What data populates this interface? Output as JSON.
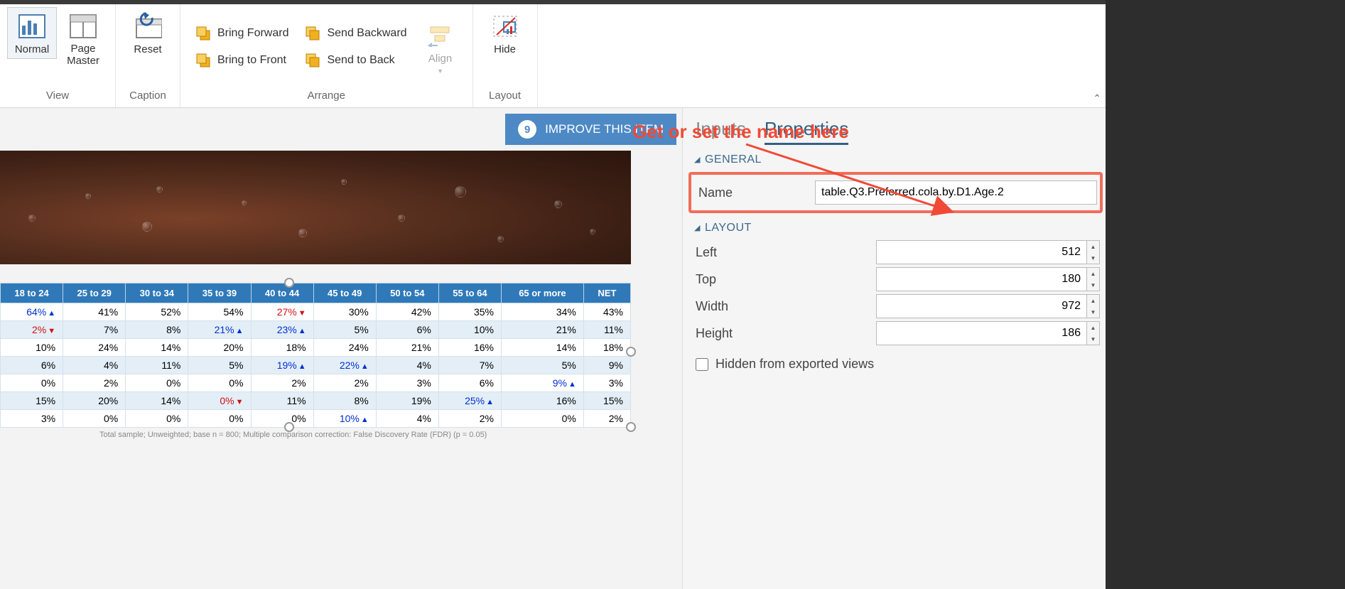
{
  "ribbon": {
    "view": {
      "label": "View",
      "normal": "Normal",
      "pageMaster": "Page\nMaster"
    },
    "caption": {
      "label": "Caption",
      "reset": "Reset"
    },
    "arrange": {
      "label": "Arrange",
      "bringForward": "Bring Forward",
      "sendBackward": "Send Backward",
      "bringToFront": "Bring to Front",
      "sendToBack": "Send to Back",
      "align": "Align"
    },
    "layout": {
      "label": "Layout",
      "hide": "Hide"
    }
  },
  "improve": {
    "count": "9",
    "label": "IMPROVE THIS ITEM"
  },
  "annotation": "Get or set the name here",
  "panel": {
    "tabs": {
      "inputs": "Inputs",
      "properties": "Properties"
    },
    "general": {
      "title": "GENERAL",
      "nameLabel": "Name",
      "nameValue": "table.Q3.Preferred.cola.by.D1.Age.2"
    },
    "layout": {
      "title": "LAYOUT",
      "leftLabel": "Left",
      "leftValue": "512",
      "topLabel": "Top",
      "topValue": "180",
      "widthLabel": "Width",
      "widthValue": "972",
      "heightLabel": "Height",
      "heightValue": "186",
      "hiddenLabel": "Hidden from exported views"
    }
  },
  "table": {
    "headers": [
      "18 to 24",
      "25 to 29",
      "30 to 34",
      "35 to 39",
      "40 to 44",
      "45 to 49",
      "50 to 54",
      "55 to 64",
      "65 or more",
      "NET"
    ],
    "rows": [
      [
        {
          "v": "64%",
          "d": "up"
        },
        {
          "v": "41%"
        },
        {
          "v": "52%"
        },
        {
          "v": "54%"
        },
        {
          "v": "27%",
          "d": "down"
        },
        {
          "v": "30%"
        },
        {
          "v": "42%"
        },
        {
          "v": "35%"
        },
        {
          "v": "34%"
        },
        {
          "v": "43%"
        }
      ],
      [
        {
          "v": "2%",
          "d": "down"
        },
        {
          "v": "7%"
        },
        {
          "v": "8%"
        },
        {
          "v": "21%",
          "d": "up"
        },
        {
          "v": "23%",
          "d": "up"
        },
        {
          "v": "5%"
        },
        {
          "v": "6%"
        },
        {
          "v": "10%"
        },
        {
          "v": "21%"
        },
        {
          "v": "11%"
        }
      ],
      [
        {
          "v": "10%"
        },
        {
          "v": "24%"
        },
        {
          "v": "14%"
        },
        {
          "v": "20%"
        },
        {
          "v": "18%"
        },
        {
          "v": "24%"
        },
        {
          "v": "21%"
        },
        {
          "v": "16%"
        },
        {
          "v": "14%"
        },
        {
          "v": "18%"
        }
      ],
      [
        {
          "v": "6%"
        },
        {
          "v": "4%"
        },
        {
          "v": "11%"
        },
        {
          "v": "5%"
        },
        {
          "v": "19%",
          "d": "up"
        },
        {
          "v": "22%",
          "d": "up"
        },
        {
          "v": "4%"
        },
        {
          "v": "7%"
        },
        {
          "v": "5%"
        },
        {
          "v": "9%"
        }
      ],
      [
        {
          "v": "0%"
        },
        {
          "v": "2%"
        },
        {
          "v": "0%"
        },
        {
          "v": "0%"
        },
        {
          "v": "2%"
        },
        {
          "v": "2%"
        },
        {
          "v": "3%"
        },
        {
          "v": "6%"
        },
        {
          "v": "9%",
          "d": "up"
        },
        {
          "v": "3%"
        }
      ],
      [
        {
          "v": "15%"
        },
        {
          "v": "20%"
        },
        {
          "v": "14%"
        },
        {
          "v": "0%",
          "d": "down"
        },
        {
          "v": "11%"
        },
        {
          "v": "8%"
        },
        {
          "v": "19%"
        },
        {
          "v": "25%",
          "d": "up"
        },
        {
          "v": "16%"
        },
        {
          "v": "15%"
        }
      ],
      [
        {
          "v": "3%"
        },
        {
          "v": "0%"
        },
        {
          "v": "0%"
        },
        {
          "v": "0%"
        },
        {
          "v": "0%"
        },
        {
          "v": "10%",
          "d": "up"
        },
        {
          "v": "4%"
        },
        {
          "v": "2%"
        },
        {
          "v": "0%"
        },
        {
          "v": "2%"
        }
      ]
    ],
    "footnote": "Total sample; Unweighted; base n = 800; Multiple comparison correction: False Discovery Rate (FDR) (p = 0.05)"
  }
}
